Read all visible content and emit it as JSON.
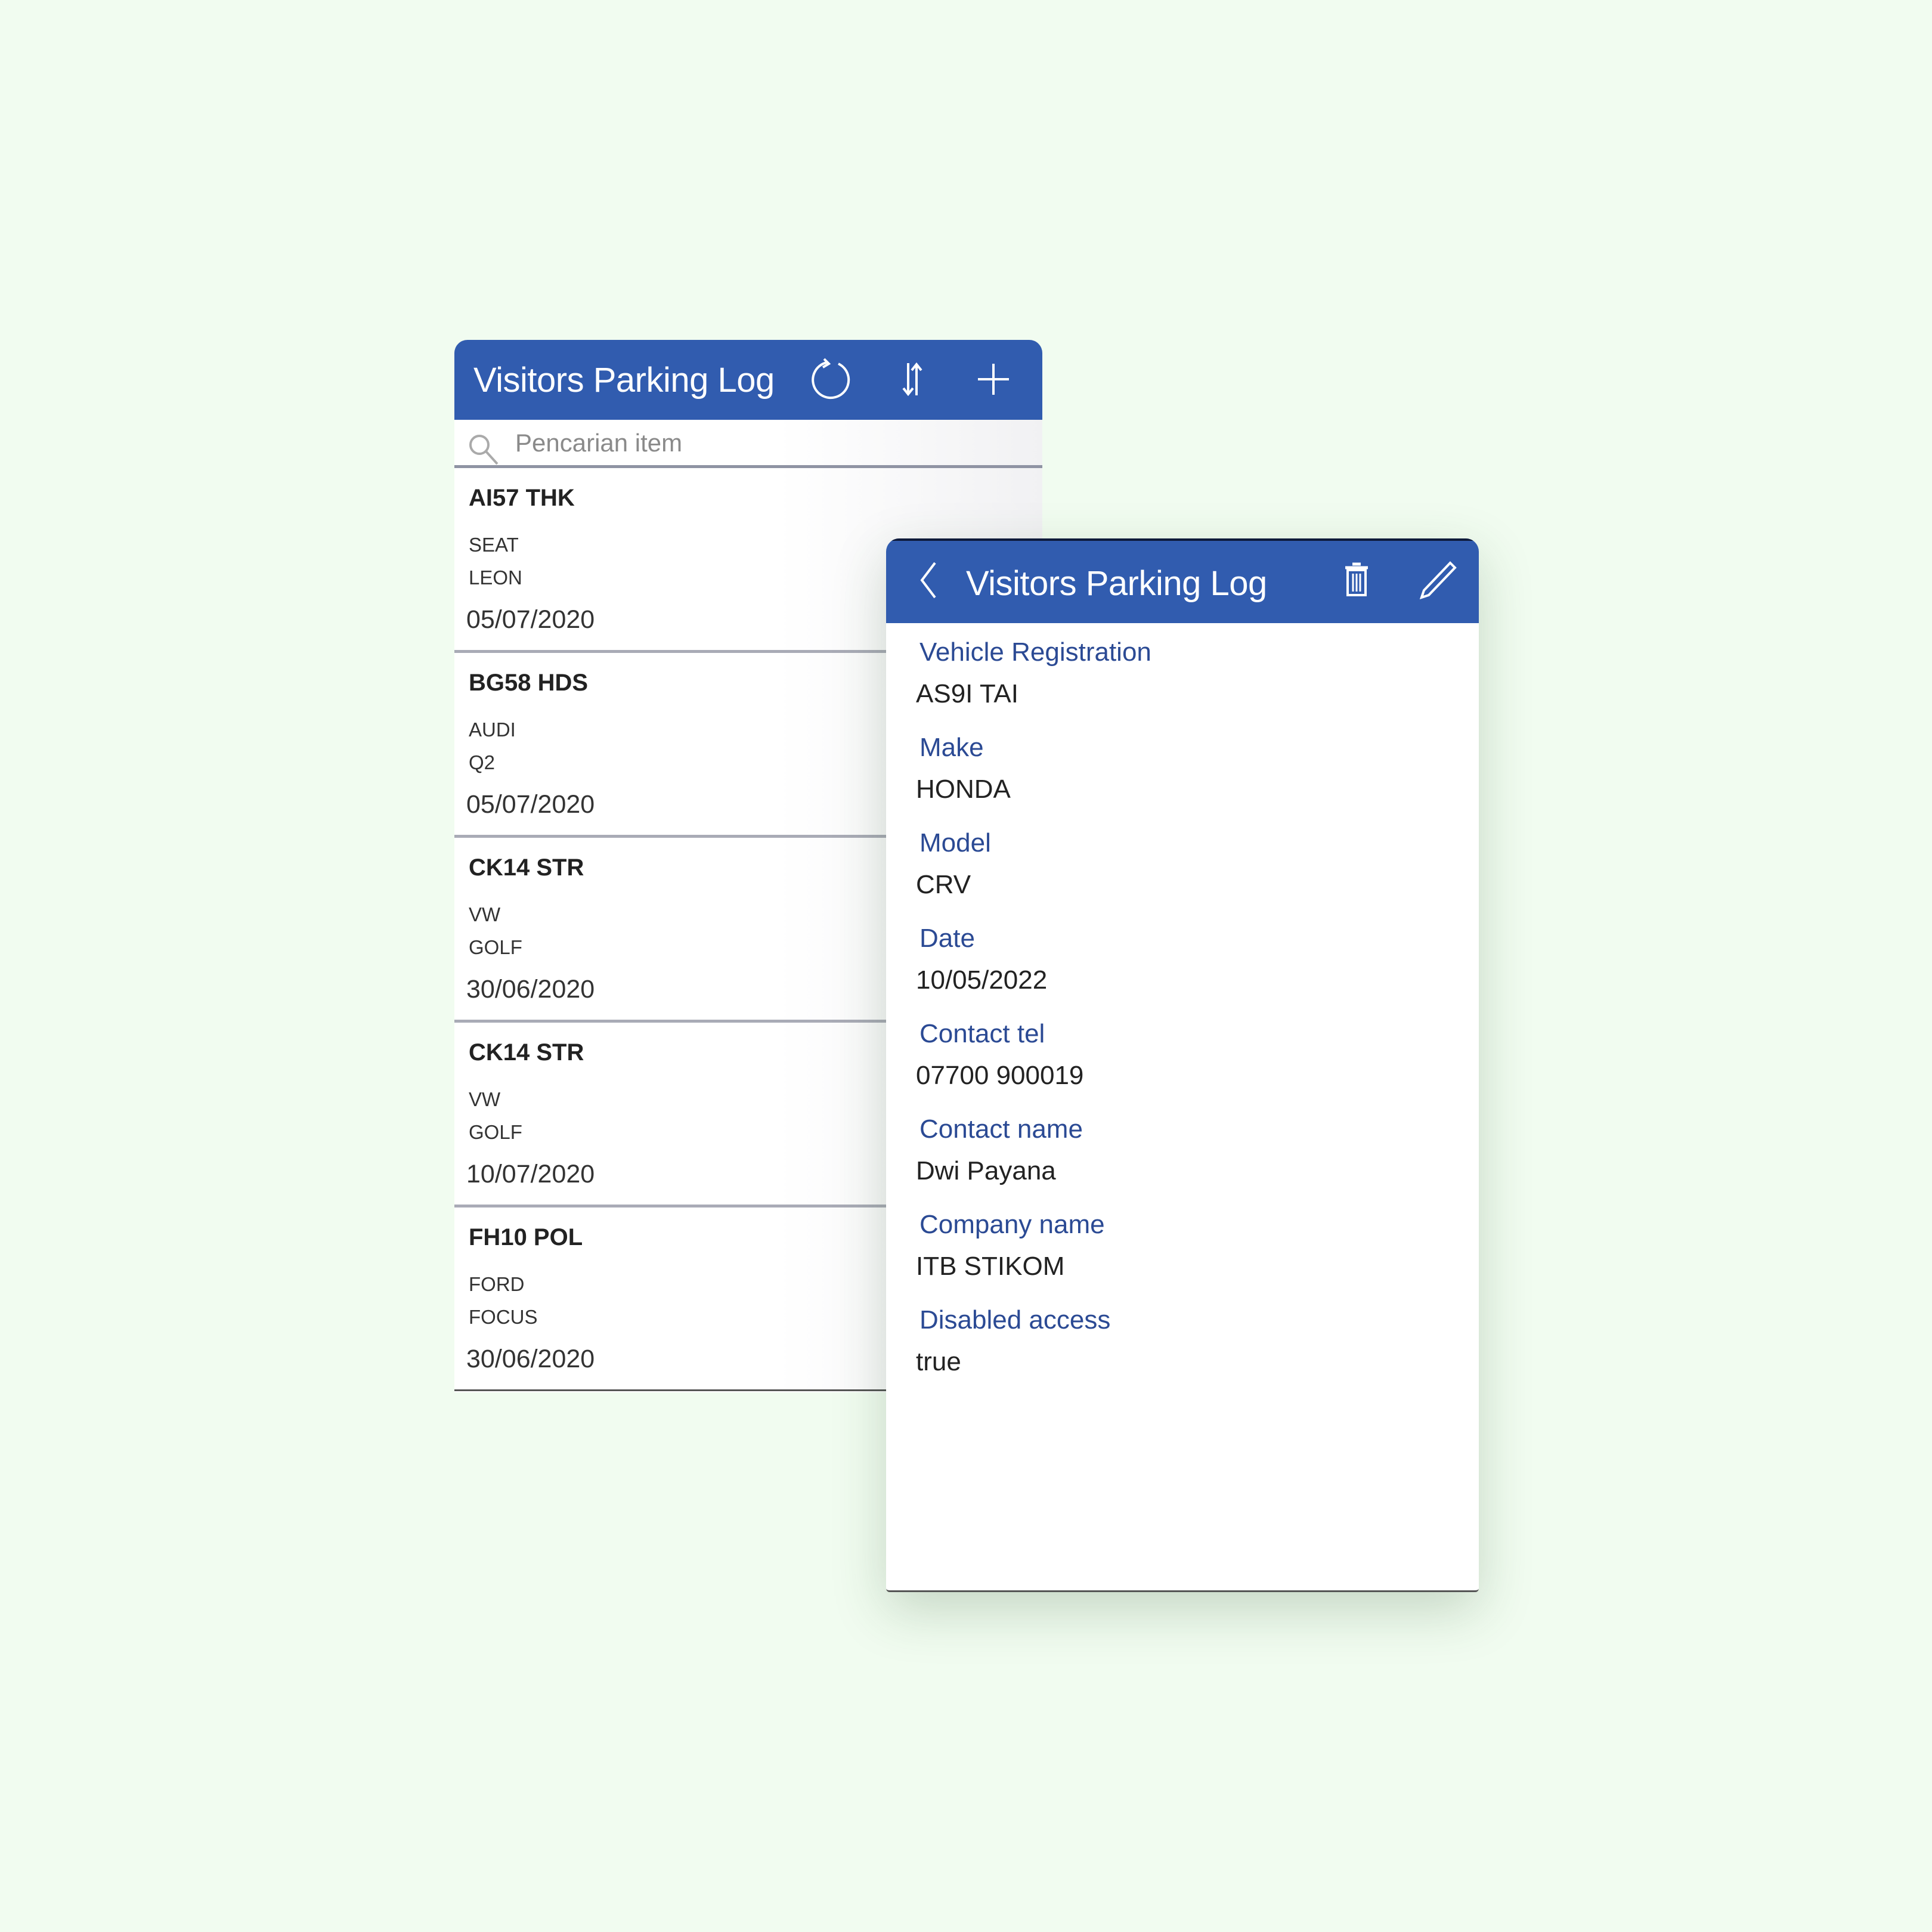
{
  "list_screen": {
    "title": "Visitors Parking Log",
    "icons": [
      "refresh-icon",
      "sort-icon",
      "add-icon"
    ],
    "search": {
      "placeholder": "Pencarian item",
      "value": ""
    },
    "items": [
      {
        "registration": "AI57 THK",
        "make": "SEAT",
        "model": "LEON",
        "date": "05/07/2020"
      },
      {
        "registration": "BG58 HDS",
        "make": "AUDI",
        "model": "Q2",
        "date": "05/07/2020"
      },
      {
        "registration": "CK14 STR",
        "make": "VW",
        "model": "GOLF",
        "date": "30/06/2020"
      },
      {
        "registration": "CK14 STR",
        "make": "VW",
        "model": "GOLF",
        "date": "10/07/2020"
      },
      {
        "registration": "FH10 POL",
        "make": "FORD",
        "model": "FOCUS",
        "date": "30/06/2020"
      }
    ]
  },
  "detail_screen": {
    "title": "Visitors Parking Log",
    "icons": [
      "back-icon",
      "delete-icon",
      "edit-icon"
    ],
    "fields": [
      {
        "label": "Vehicle Registration",
        "value": "AS9I TAI"
      },
      {
        "label": "Make",
        "value": "HONDA"
      },
      {
        "label": "Model",
        "value": "CRV"
      },
      {
        "label": "Date",
        "value": "10/05/2022"
      },
      {
        "label": "Contact tel",
        "value": "07700 900019"
      },
      {
        "label": "Contact name",
        "value": "Dwi Payana"
      },
      {
        "label": "Company name",
        "value": "ITB STIKOM"
      },
      {
        "label": "Disabled access",
        "value": "true"
      }
    ]
  },
  "colors": {
    "header": "#315caf",
    "label": "#2b4a94",
    "background": "#f1fcf0"
  }
}
